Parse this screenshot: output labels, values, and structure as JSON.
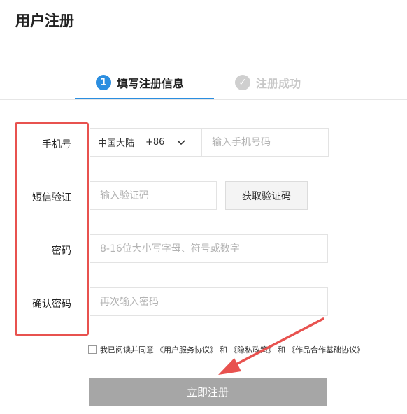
{
  "page": {
    "title": "用户注册"
  },
  "steps": [
    {
      "number": "1",
      "label": "填写注册信息",
      "state": "active"
    },
    {
      "number": "✓",
      "label": "注册成功",
      "state": "inactive"
    }
  ],
  "form": {
    "phone": {
      "label": "手机号",
      "country": "中国大陆",
      "code": "+86",
      "placeholder": "输入手机号码",
      "value": ""
    },
    "sms": {
      "label": "短信验证",
      "placeholder": "输入验证码",
      "value": "",
      "button": "获取验证码"
    },
    "password": {
      "label": "密码",
      "placeholder": "8-16位大小写字母、符号或数字",
      "value": ""
    },
    "confirm": {
      "label": "确认密码",
      "placeholder": "再次输入密码",
      "value": ""
    }
  },
  "agreement": {
    "prefix": "我已阅读并同意",
    "link1": "《用户服务协议》",
    "and1": "和",
    "link2": "《隐私政策》",
    "and2": "和",
    "link3": "《作品合作基础协议》",
    "checked": false
  },
  "submit": {
    "label": "立即注册"
  },
  "colors": {
    "accent": "#2b8ee0",
    "annotation": "#e8524f",
    "submit_bg": "#a6a6a6"
  }
}
